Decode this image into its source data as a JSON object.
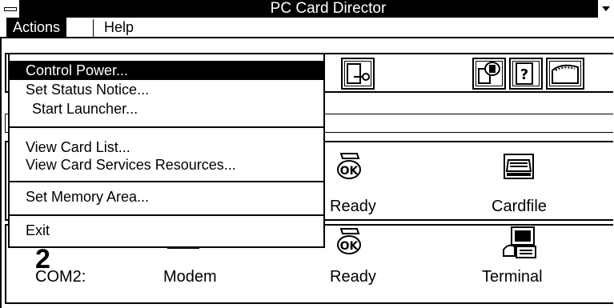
{
  "title": "PC Card Director",
  "menubar": {
    "actions": "Actions",
    "help": "Help"
  },
  "menu": {
    "items": [
      "Control Power...",
      "Set Status Notice...",
      "Start Launcher...",
      "View Card List...",
      "View Card Services Resources...",
      "Set Memory Area...",
      "Exit"
    ]
  },
  "slots": [
    {
      "status": "Ready",
      "app": "Cardfile"
    },
    {
      "number": "2",
      "port": "COM2:",
      "card": "Modem",
      "status": "Ready",
      "app": "Terminal"
    }
  ],
  "toolbar_icons": [
    "key-card-icon",
    "card-info-icon",
    "help-book-icon",
    "folder-icon"
  ],
  "status_icon": "ok-icon"
}
